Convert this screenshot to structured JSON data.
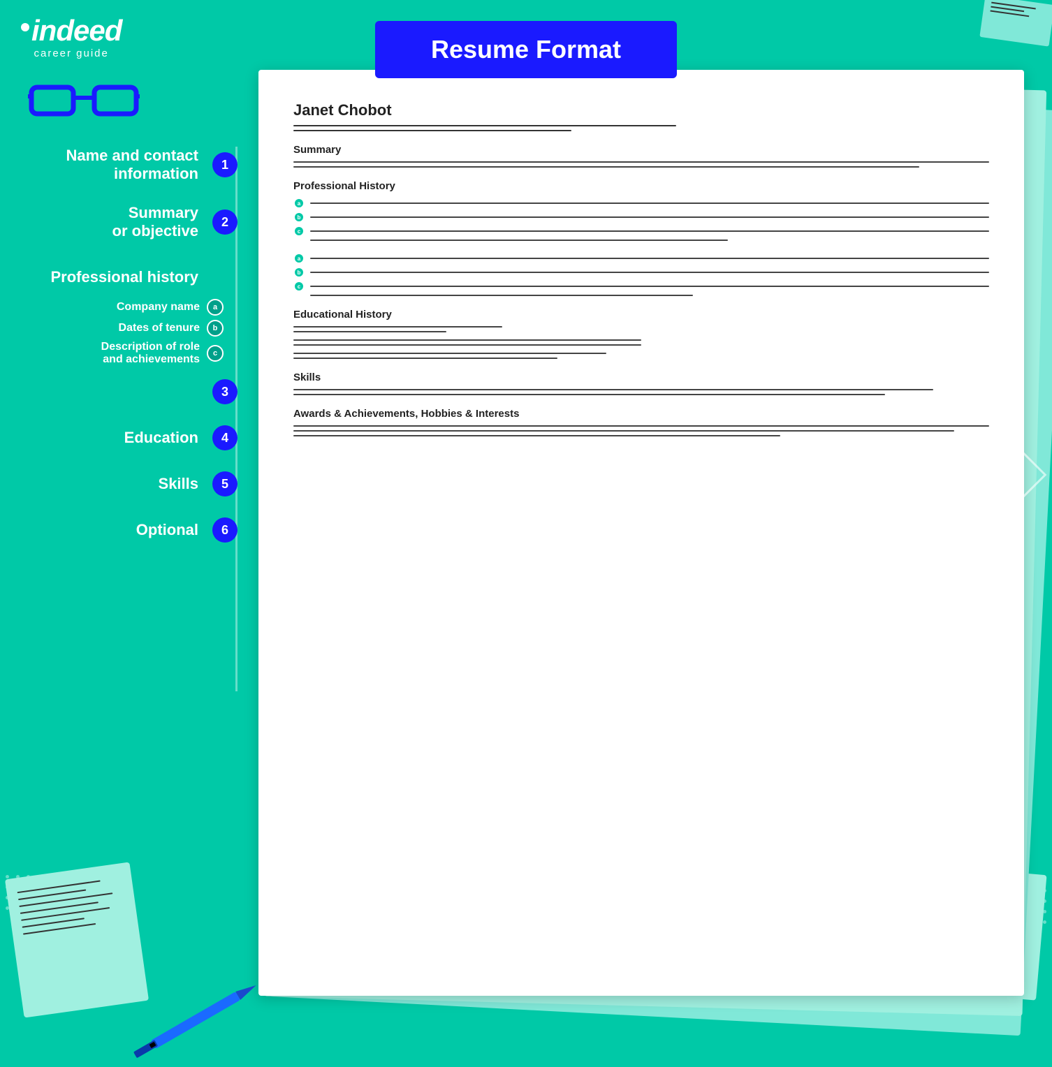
{
  "header": {
    "title": "Resume Format"
  },
  "logo": {
    "brand": "indeed",
    "tagline": "career guide"
  },
  "sidebar": {
    "items": [
      {
        "id": 1,
        "label": "Name and contact information",
        "badge": "1"
      },
      {
        "id": 2,
        "label": "Summary",
        "label2": "or objective",
        "badge": "2"
      },
      {
        "id": 3,
        "label": "Professional history",
        "badge": "3",
        "subItems": [
          {
            "label": "Company name",
            "badge": "a"
          },
          {
            "label": "Dates of tenure",
            "badge": "b"
          },
          {
            "label": "Description of role and achievements",
            "badge": "c"
          }
        ]
      },
      {
        "id": 4,
        "label": "Education",
        "badge": "4"
      },
      {
        "id": 5,
        "label": "Skills",
        "badge": "5"
      },
      {
        "id": 6,
        "label": "Optional",
        "badge": "6"
      }
    ]
  },
  "resume": {
    "name": "Janet Chobot",
    "sections": [
      {
        "title": "Summary"
      },
      {
        "title": "Professional History"
      },
      {
        "title": "Educational History"
      },
      {
        "title": "Skills"
      },
      {
        "title": "Awards & Achievements, Hobbies & Interests"
      }
    ]
  }
}
